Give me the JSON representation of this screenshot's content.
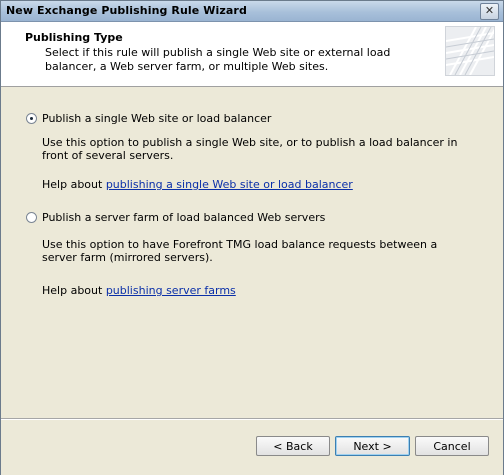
{
  "window": {
    "title": "New Exchange Publishing Rule Wizard",
    "close_glyph": "✕"
  },
  "header": {
    "title": "Publishing Type",
    "subtitle": "Select if this rule will publish a single Web site or external load balancer, a Web server farm, or multiple Web sites."
  },
  "options": [
    {
      "label": "Publish a single Web site or load balancer",
      "checked": true,
      "description": "Use this option to publish a single Web site, or to publish a load balancer in front of several servers.",
      "help_prefix": "Help about ",
      "help_link": "publishing a single Web site or load balancer"
    },
    {
      "label": "Publish a server farm of load balanced Web servers",
      "checked": false,
      "description": "Use this option to have Forefront TMG load balance requests between a server farm (mirrored servers).",
      "help_prefix": "Help about ",
      "help_link": "publishing server farms"
    }
  ],
  "buttons": {
    "back": "< Back",
    "next": "Next >",
    "cancel": "Cancel"
  }
}
